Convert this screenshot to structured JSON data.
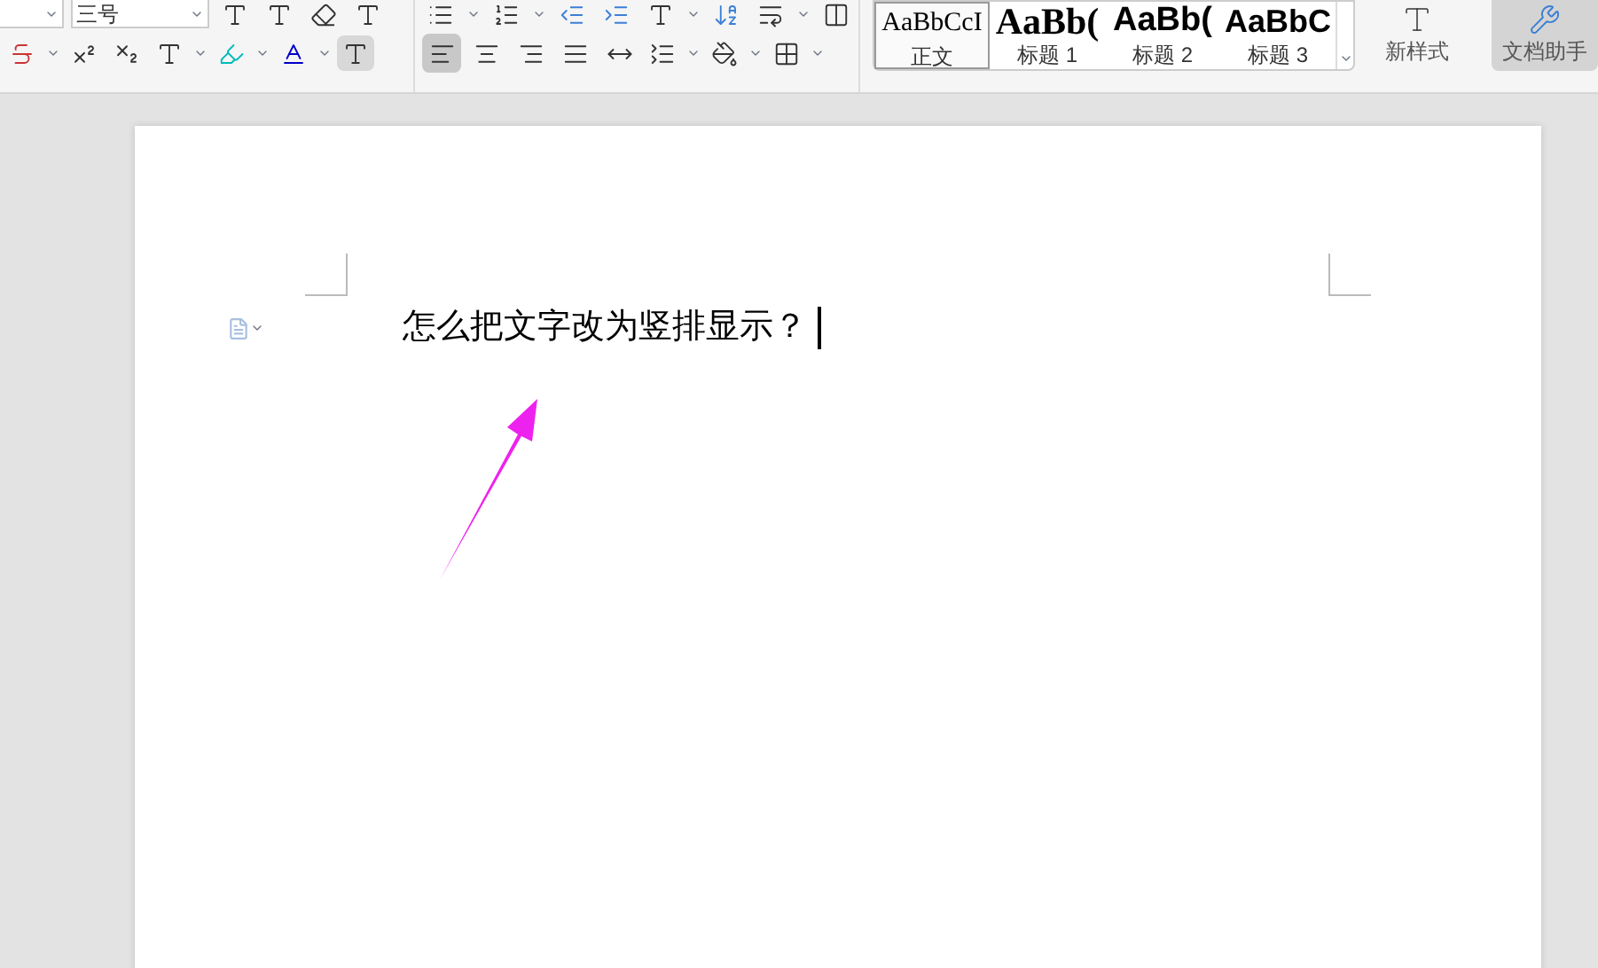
{
  "toolbar": {
    "font_size": "三号",
    "alignment": [
      {
        "kind": "left",
        "selected": true
      },
      {
        "kind": "center",
        "selected": false
      },
      {
        "kind": "right",
        "selected": false
      },
      {
        "kind": "justify",
        "selected": false
      },
      {
        "kind": "distributed",
        "selected": false
      }
    ],
    "styles": [
      {
        "sample": "AaBbCcI",
        "label": "正文",
        "selected": true,
        "kind": "body"
      },
      {
        "sample": "AaBb(",
        "label": "标题 1",
        "selected": false,
        "kind": "h1"
      },
      {
        "sample": "AaBb(",
        "label": "标题 2",
        "selected": false,
        "kind": "h2"
      },
      {
        "sample": "AaBbC",
        "label": "标题 3",
        "selected": false,
        "kind": "h3"
      }
    ],
    "new_style": "新样式",
    "assistant": "文档助手"
  },
  "document": {
    "paragraph": "怎么把文字改为竖排显示？"
  }
}
